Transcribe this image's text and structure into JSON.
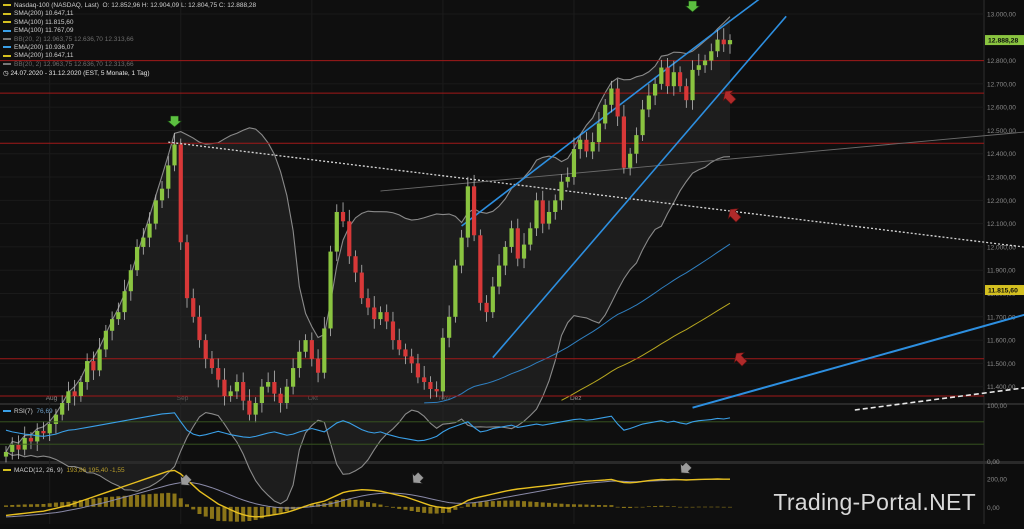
{
  "header": {
    "instrument": "Nasdaq-100 (NASDAQ, Last)",
    "ohlc": "O: 12.852,96  H: 12.904,09  L: 12.804,75  C: 12.888,28",
    "indicators": [
      {
        "label": "SMA(200)",
        "value": "10.647,11",
        "color": "#d4c020",
        "dim": false
      },
      {
        "label": "SMA(100)",
        "value": "11.815,60",
        "color": "#d4c020",
        "dim": false
      },
      {
        "label": "EMA(100)",
        "value": "11.767,09",
        "color": "#3aa0e8",
        "dim": false
      },
      {
        "label": "BB(20, 2)",
        "value": "12.963,75  12.636,70  12.313,66",
        "color": "#777777",
        "dim": true
      },
      {
        "label": "EMA(200)",
        "value": "10.936,07",
        "color": "#3aa0e8",
        "dim": false
      },
      {
        "label": "SMA(200)",
        "value": "10.647,11",
        "color": "#d4c020",
        "dim": false
      },
      {
        "label": "BB(20, 2)",
        "value": "12.963,75  12.636,70  12.313,66",
        "color": "#777777",
        "dim": true
      }
    ],
    "period": "24.07.2020 - 31.12.2020   (EST, 5 Monate, 1 Tag)"
  },
  "watermark": "Trading-Portal.NET",
  "chart_data": [
    {
      "type": "candlestick",
      "title": "Nasdaq-100",
      "x_labels": [
        {
          "label": "Aug",
          "index": 7
        },
        {
          "label": "Sep",
          "index": 28
        },
        {
          "label": "Okt",
          "index": 49
        },
        {
          "label": "Nov",
          "index": 70
        },
        {
          "label": "Dez",
          "index": 91
        }
      ],
      "y_ticks": [
        "11.400,00",
        "11.500,00",
        "11.600,00",
        "11.700,00",
        "11.800,00",
        "11.900,00",
        "12.000,00",
        "12.100,00",
        "12.200,00",
        "12.300,00",
        "12.400,00",
        "12.500,00",
        "12.600,00",
        "12.700,00",
        "12.800,00",
        "13.000,00"
      ],
      "ylim": [
        11330,
        13060
      ],
      "last_close_label": "12.888,28",
      "sma_label": "11.815,60",
      "horizontal_levels": [
        12800,
        12660,
        12445,
        11520,
        11360
      ],
      "closes": [
        11120,
        11150,
        11130,
        11180,
        11165,
        11210,
        11200,
        11240,
        11280,
        11330,
        11380,
        11360,
        11420,
        11510,
        11470,
        11560,
        11640,
        11690,
        11720,
        11810,
        11900,
        12000,
        12040,
        12100,
        12200,
        12250,
        12350,
        12440,
        12020,
        11780,
        11700,
        11600,
        11520,
        11480,
        11430,
        11360,
        11380,
        11420,
        11340,
        11280,
        11330,
        11400,
        11420,
        11370,
        11330,
        11400,
        11480,
        11550,
        11600,
        11520,
        11460,
        11650,
        11980,
        12150,
        12110,
        11960,
        11890,
        11780,
        11740,
        11690,
        11720,
        11680,
        11600,
        11560,
        11530,
        11500,
        11440,
        11420,
        11390,
        11380,
        11610,
        11700,
        11920,
        12040,
        12260,
        12050,
        11760,
        11720,
        11830,
        11920,
        12000,
        12080,
        11950,
        12010,
        12080,
        12200,
        12100,
        12150,
        12200,
        12280,
        12300,
        12420,
        12460,
        12410,
        12450,
        12530,
        12610,
        12680,
        12560,
        12340,
        12400,
        12480,
        12590,
        12650,
        12700,
        12770,
        12690,
        12750,
        12690,
        12630,
        12760,
        12780,
        12800,
        12840,
        12890,
        12870,
        12888
      ]
    },
    {
      "type": "line",
      "title": "RSI(7)",
      "values_label": "76,69",
      "y_ticks": [
        "100,00",
        "0,00"
      ],
      "ylim": [
        0,
        100
      ],
      "values": [
        55,
        52,
        50,
        48,
        47,
        45,
        44,
        46,
        48,
        52,
        55,
        56,
        58,
        60,
        62,
        64,
        66,
        68,
        70,
        72,
        74,
        76,
        78,
        80,
        82,
        84,
        85,
        86,
        70,
        55,
        48,
        45,
        47,
        50,
        53,
        50,
        47,
        45,
        43,
        42,
        44,
        47,
        50,
        52,
        49,
        46,
        48,
        52,
        55,
        58,
        55,
        52,
        60,
        68,
        72,
        68,
        62,
        56,
        52,
        50,
        52,
        48,
        45,
        42,
        40,
        38,
        36,
        37,
        40,
        44,
        52,
        58,
        62,
        66,
        70,
        60,
        52,
        54,
        58,
        60,
        62,
        64,
        60,
        62,
        64,
        66,
        64,
        66,
        68,
        70,
        72,
        74,
        75,
        73,
        74,
        76,
        78,
        80,
        66,
        55,
        58,
        62,
        66,
        68,
        70,
        72,
        69,
        71,
        68,
        66,
        70,
        72,
        73,
        74,
        76,
        75,
        77
      ],
      "levels": [
        70,
        30
      ]
    },
    {
      "type": "bar+line",
      "title": "MACD(12, 26, 9)",
      "values_label": "193,86  195,40  -1,55",
      "y_ticks": [
        "200,00",
        "0,00"
      ],
      "ylim": [
        -120,
        300
      ],
      "macd": [
        -60,
        -55,
        -50,
        -45,
        -40,
        -35,
        -30,
        -20,
        -10,
        0,
        10,
        25,
        40,
        55,
        70,
        85,
        100,
        115,
        130,
        145,
        160,
        175,
        190,
        205,
        220,
        235,
        250,
        255,
        230,
        190,
        150,
        110,
        80,
        50,
        20,
        0,
        -20,
        -40,
        -55,
        -65,
        -70,
        -68,
        -62,
        -55,
        -48,
        -38,
        -25,
        -10,
        5,
        20,
        30,
        40,
        60,
        80,
        100,
        110,
        115,
        120,
        118,
        115,
        110,
        100,
        90,
        80,
        70,
        55,
        40,
        25,
        10,
        0,
        -5,
        -10,
        5,
        20,
        45,
        60,
        70,
        80,
        90,
        100,
        110,
        118,
        125,
        130,
        135,
        140,
        145,
        150,
        155,
        160,
        165,
        170,
        175,
        180,
        182,
        185,
        188,
        192,
        180,
        170,
        168,
        172,
        178,
        184,
        188,
        192,
        190,
        192,
        190,
        188,
        190,
        192,
        193,
        194,
        195,
        194,
        194
      ],
      "signal": [
        -70,
        -68,
        -65,
        -62,
        -58,
        -54,
        -50,
        -45,
        -40,
        -33,
        -25,
        -17,
        -8,
        2,
        12,
        22,
        32,
        44,
        56,
        68,
        80,
        92,
        104,
        116,
        128,
        140,
        152,
        162,
        170,
        172,
        168,
        160,
        148,
        134,
        118,
        100,
        82,
        64,
        48,
        34,
        22,
        12,
        4,
        -2,
        -6,
        -8,
        -8,
        -6,
        -3,
        2,
        8,
        14,
        22,
        32,
        44,
        56,
        66,
        76,
        84,
        90,
        94,
        96,
        96,
        94,
        90,
        84,
        76,
        67,
        57,
        47,
        38,
        30,
        26,
        24,
        26,
        30,
        36,
        42,
        50,
        58,
        66,
        74,
        82,
        90,
        98,
        106,
        114,
        122,
        130,
        138,
        146,
        152,
        158,
        164,
        168,
        172,
        176,
        180,
        180,
        178,
        176,
        176,
        178,
        180,
        182,
        184,
        186,
        188,
        190,
        190,
        190,
        191,
        192,
        193,
        194,
        195,
        195
      ],
      "arrows": [
        "down",
        "down",
        "down"
      ]
    }
  ]
}
